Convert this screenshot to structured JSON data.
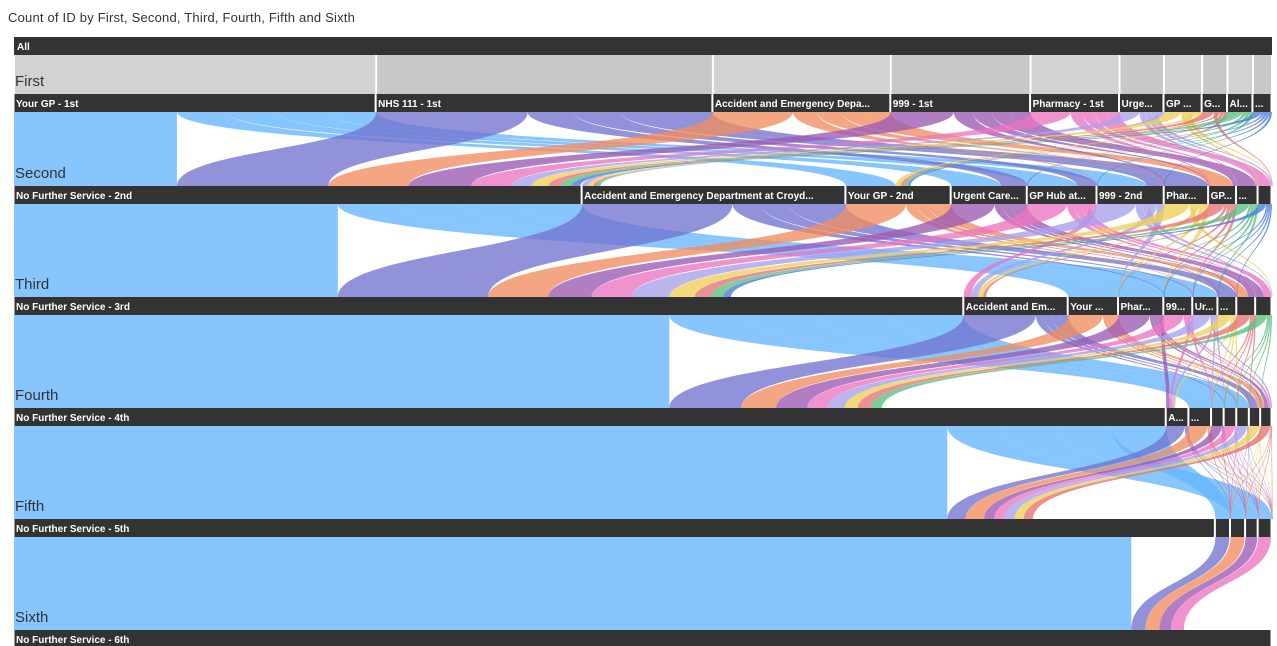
{
  "title": "Count of ID by First, Second, Third, Fourth, Fifth and Sixth",
  "root_label": "All",
  "chart_data": {
    "type": "decomposition-tree",
    "title": "Count of ID by First, Second, Third, Fourth, Fifth and Sixth",
    "colors": [
      "#4aa8ff",
      "#5a5cc8",
      "#ee7a45",
      "#8a3ea6",
      "#e85cb5",
      "#9a8fe8",
      "#ecc63a",
      "#e05a5a",
      "#3fb36a",
      "#2a63d6"
    ],
    "levels": [
      {
        "name": "First",
        "segments": [
          {
            "label": "Your GP - 1st",
            "value": 28.5
          },
          {
            "label": "NHS 111 - 1st",
            "value": 26.5
          },
          {
            "label": "Accident and Emergency Depa...",
            "value": 14
          },
          {
            "label": "999 - 1st",
            "value": 11
          },
          {
            "label": "Pharmacy - 1st",
            "value": 7
          },
          {
            "label": "Urge...",
            "value": 3.5
          },
          {
            "label": "GP ...",
            "value": 3
          },
          {
            "label": "G...",
            "value": 2
          },
          {
            "label": "Al...",
            "value": 2
          },
          {
            "label": "...",
            "value": 1.5
          }
        ]
      },
      {
        "name": "Second",
        "segments": [
          {
            "label": "No Further Service - 2nd",
            "value": 44.8
          },
          {
            "label": "Accident and Emergency Department at Croyd...",
            "value": 20.8
          },
          {
            "label": "Your GP - 2nd",
            "value": 8.3
          },
          {
            "label": "Urgent Care...",
            "value": 6
          },
          {
            "label": "GP Hub at...",
            "value": 5.5
          },
          {
            "label": "999 - 2nd",
            "value": 5.3
          },
          {
            "label": "Phar...",
            "value": 3.5
          },
          {
            "label": "GP...",
            "value": 2.2
          },
          {
            "label": "...",
            "value": 1.7
          },
          {
            "label": "",
            "value": 1.1
          }
        ]
      },
      {
        "name": "Third",
        "segments": [
          {
            "label": "No Further Service - 3rd",
            "value": 75.5
          },
          {
            "label": "Accident and Em...",
            "value": 8.3
          },
          {
            "label": "Your ...",
            "value": 4
          },
          {
            "label": "Phar...",
            "value": 3.6
          },
          {
            "label": "99...",
            "value": 2.3
          },
          {
            "label": "Ur...",
            "value": 2
          },
          {
            "label": "...",
            "value": 1.5
          },
          {
            "label": "",
            "value": 1.5
          },
          {
            "label": "",
            "value": 1.3
          }
        ]
      },
      {
        "name": "Fourth",
        "segments": [
          {
            "label": "No Further Service - 4th",
            "value": 91.5
          },
          {
            "label": "A...",
            "value": 1.8
          },
          {
            "label": "...",
            "value": 1.8
          },
          {
            "label": "",
            "value": 1
          },
          {
            "label": "",
            "value": 1
          },
          {
            "label": "",
            "value": 1
          },
          {
            "label": "",
            "value": 0.9
          },
          {
            "label": "",
            "value": 0.9
          }
        ]
      },
      {
        "name": "Fifth",
        "segments": [
          {
            "label": "No Further Service - 5th",
            "value": 95.5
          },
          {
            "label": "",
            "value": 1.2
          },
          {
            "label": "",
            "value": 1.2
          },
          {
            "label": "",
            "value": 1
          },
          {
            "label": "",
            "value": 1.1
          }
        ]
      },
      {
        "name": "Sixth",
        "segments": [
          {
            "label": "No Further Service - 6th",
            "value": 100
          }
        ]
      }
    ],
    "ribbons_by_first_level": [
      {
        "color": "#4aa8ff",
        "first_share": 28.5
      },
      {
        "color": "#5a5cc8",
        "first_share": 26.5
      },
      {
        "color": "#ee7a45",
        "first_share": 14
      },
      {
        "color": "#8a3ea6",
        "first_share": 11
      },
      {
        "color": "#e85cb5",
        "first_share": 7
      },
      {
        "color": "#9a8fe8",
        "first_share": 3.5
      },
      {
        "color": "#ecc63a",
        "first_share": 3
      },
      {
        "color": "#e05a5a",
        "first_share": 2
      },
      {
        "color": "#3fb36a",
        "first_share": 2
      },
      {
        "color": "#2a63d6",
        "first_share": 1.5
      }
    ]
  }
}
